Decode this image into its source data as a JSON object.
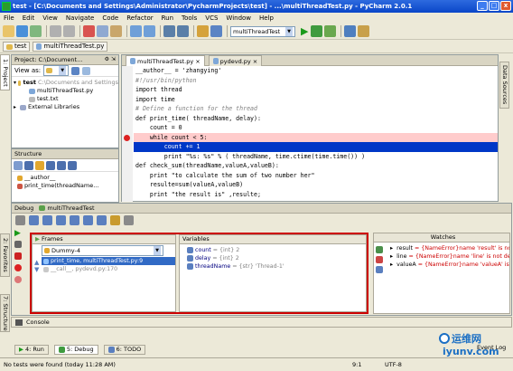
{
  "window": {
    "title": "test - [C:\\Documents and Settings\\Administrator\\PycharmProjects\\test] - ...\\multiThreadTest.py - PyCharm 2.0.1"
  },
  "menu": [
    "File",
    "Edit",
    "View",
    "Navigate",
    "Code",
    "Refactor",
    "Run",
    "Tools",
    "VCS",
    "Window",
    "Help"
  ],
  "toolbar": {
    "run_config": "multiThreadTest"
  },
  "navbar": {
    "crumbs": [
      "test",
      "multiThreadTest.py"
    ]
  },
  "project": {
    "header": "Project: C:\\Document...",
    "view_as": "View as:",
    "tree": [
      {
        "label": "test",
        "extra": "C:\\Documents and Settings",
        "indent": 0,
        "kind": "folder"
      },
      {
        "label": "multiThreadTest.py",
        "extra": "",
        "indent": 1,
        "kind": "file"
      },
      {
        "label": "test.txt",
        "extra": "",
        "indent": 1,
        "kind": "text"
      },
      {
        "label": "External Libraries",
        "extra": "",
        "indent": 0,
        "kind": "lib"
      }
    ]
  },
  "structure": {
    "header": "Structure",
    "items": [
      "__author__",
      "print_time(threadName..."
    ]
  },
  "editor": {
    "tabs": [
      {
        "label": "multiThreadTest.py",
        "active": true
      },
      {
        "label": "pydevd.py",
        "active": false
      }
    ],
    "lines": [
      {
        "text": "__author__ = 'zhangying'",
        "style": "normal"
      },
      {
        "text": "#!/usr/bin/python",
        "style": "comment"
      },
      {
        "text": "import thread",
        "style": "normal"
      },
      {
        "text": "import time",
        "style": "normal"
      },
      {
        "text": "# Define a function for the thread",
        "style": "comment"
      },
      {
        "text": "def print_time( threadName, delay):",
        "style": "normal"
      },
      {
        "text": "    count = 0",
        "style": "normal"
      },
      {
        "text": "    while count < 5:",
        "style": "bp"
      },
      {
        "text": "        count += 1",
        "style": "exec"
      },
      {
        "text": "        print \"%s: %s\" % ( threadName, time.ctime(time.time()) )",
        "style": "normal"
      },
      {
        "text": "def check_sum(threadName,valueA,valueB):",
        "style": "normal"
      },
      {
        "text": "    print \"to calculate the sum of two number her\"",
        "style": "normal"
      },
      {
        "text": "    resulte=sum(valueA,valueB)",
        "style": "normal"
      },
      {
        "text": "    print \"the result is\" ,resulte;",
        "style": "normal"
      }
    ]
  },
  "side_tabs": {
    "left_top": "1: Project",
    "left_mid": "7: Structure",
    "left_bottom": "2: Favorites",
    "right": "Data Sources"
  },
  "debug": {
    "header_label": "Debug",
    "header_tab": "multiThreadTest",
    "frames": {
      "title": "Frames",
      "thread": "Dummy-4",
      "items": [
        {
          "label": "print_time, multiThreadTest.py:9",
          "selected": true
        },
        {
          "label": "__call__, pydevd.py:170",
          "selected": false
        }
      ]
    },
    "variables": {
      "title": "Variables",
      "items": [
        {
          "name": "count",
          "type": "= {int} 2"
        },
        {
          "name": "delay",
          "type": "= {int} 2"
        },
        {
          "name": "threadName",
          "type": "= {str} 'Thread-1'"
        }
      ]
    },
    "watches": {
      "title": "Watches",
      "items": [
        {
          "name": "result",
          "value": "= {NameError}name 'result' is not"
        },
        {
          "name": "line",
          "value": "= {NameError}name 'line' is not def"
        },
        {
          "name": "valueA",
          "value": "= {NameError}name 'valueA' is no"
        }
      ]
    }
  },
  "console": {
    "label": "Console"
  },
  "tool_tabs": [
    "4: Run",
    "5: Debug",
    "6: TODO"
  ],
  "event_log": "Event Log",
  "status": {
    "message": "No tests were found (today 11:28 AM)",
    "position": "9:1",
    "encoding": "UTF-8"
  },
  "watermark": {
    "cn": "运维网",
    "url": "iyunv.com"
  }
}
